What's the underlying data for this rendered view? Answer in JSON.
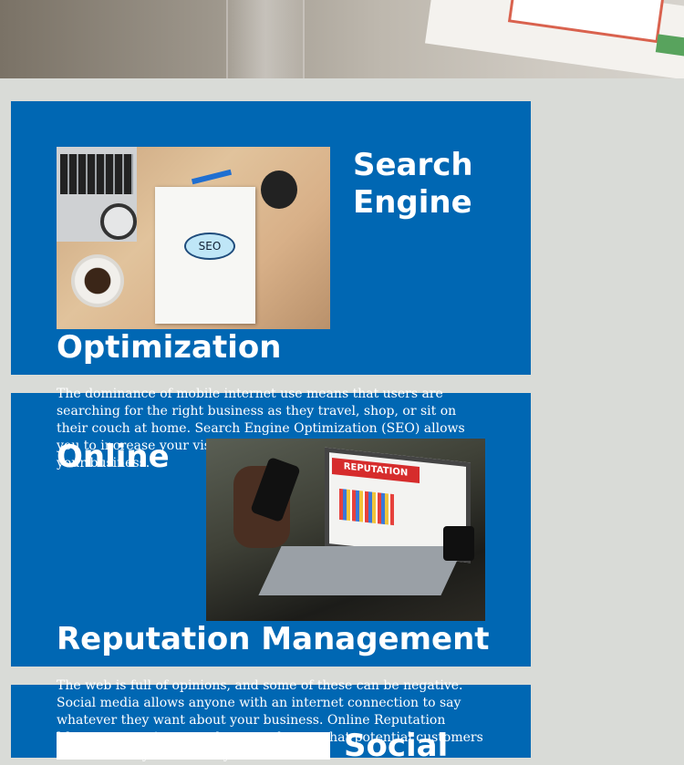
{
  "cards": [
    {
      "title_line1": "Search",
      "title_line2": "Engine",
      "title_line3": "Optimization",
      "description": "The dominance of mobile internet use means that users are searching for the right business as they travel, shop, or sit on their couch at home. Search Engine Optimization (SEO) allows you to increase your visibility and find the right customers for your business.",
      "image_text": "SEO"
    },
    {
      "title_line1": "Online",
      "title_line2": "Reputation Management",
      "description": "The web is full of opinions, and some of these can be negative. Social media allows anyone with an internet connection to say whatever they want about your business. Online Reputation Management gives you the control over what potential customers see when they search for your",
      "image_text": "REPUTATION"
    },
    {
      "title_line1": "Social"
    }
  ]
}
